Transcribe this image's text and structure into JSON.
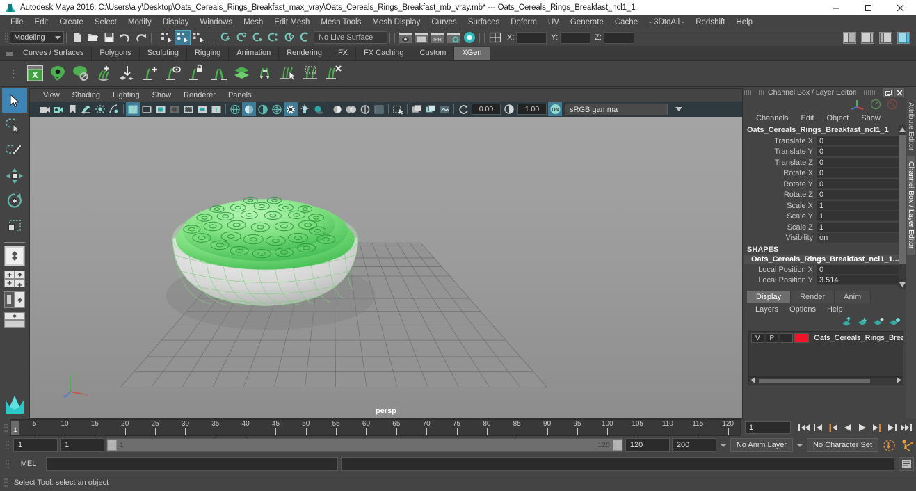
{
  "window": {
    "title": "Autodesk Maya 2016: C:\\Users\\a y\\Desktop\\Oats_Cereals_Rings_Breakfast_max_vray\\Oats_Cereals_Rings_Breakfast_mb_vray.mb*  ---  Oats_Cereals_Rings_Breakfast_ncl1_1",
    "minimize": "─",
    "maximize": "❐",
    "close": "✕"
  },
  "menubar": {
    "items": [
      "File",
      "Edit",
      "Create",
      "Select",
      "Modify",
      "Display",
      "Windows",
      "Mesh",
      "Edit Mesh",
      "Mesh Tools",
      "Mesh Display",
      "Curves",
      "Surfaces",
      "Deform",
      "UV",
      "Generate",
      "Cache",
      "- 3DtoAll -",
      "Redshift",
      "Help"
    ]
  },
  "statusline": {
    "menuset": "Modeling",
    "live_surface": "No Live Surface",
    "coord_x_label": "X:",
    "coord_y_label": "Y:",
    "coord_z_label": "Z:",
    "coord_x": "",
    "coord_y": "",
    "coord_z": ""
  },
  "shelf": {
    "tabs": [
      "Curves / Surfaces",
      "Polygons",
      "Sculpting",
      "Rigging",
      "Animation",
      "Rendering",
      "FX",
      "FX Caching",
      "Custom",
      "XGen"
    ],
    "active_tab": "XGen",
    "icons": [
      "xgen-window-icon",
      "xgen-preview-icon",
      "xgen-preview-off-icon",
      "xgen-add-description-icon",
      "xgen-place-guide-icon",
      "xgen-add-guide-icon",
      "xgen-guide-visibility-icon",
      "xgen-lock-guide-icon",
      "xgen-mirror-guide-icon",
      "xgen-layers-icon",
      "xgen-convert-guide-icon",
      "xgen-select-guide-icon",
      "xgen-region-icon",
      "xgen-delete-guide-icon"
    ]
  },
  "toolbox": {
    "tools": [
      {
        "name": "select-tool",
        "selected": true
      },
      {
        "name": "lasso-select-tool",
        "selected": false
      },
      {
        "name": "paint-select-tool",
        "selected": false
      },
      {
        "name": "move-tool",
        "selected": false
      },
      {
        "name": "rotate-tool",
        "selected": false
      },
      {
        "name": "scale-tool",
        "selected": false
      }
    ]
  },
  "viewport": {
    "menus": [
      "View",
      "Shading",
      "Lighting",
      "Show",
      "Renderer",
      "Panels"
    ],
    "exposure": "0.00",
    "gamma": "1.00",
    "color_profile": "sRGB gamma",
    "camera_label": "persp"
  },
  "channelbox": {
    "panel_title": "Channel Box / Layer Editor",
    "menus": [
      "Channels",
      "Edit",
      "Object",
      "Show"
    ],
    "object_name": "Oats_Cereals_Rings_Breakfast_ncl1_1",
    "channels": [
      {
        "label": "Translate X",
        "value": "0"
      },
      {
        "label": "Translate Y",
        "value": "0"
      },
      {
        "label": "Translate Z",
        "value": "0"
      },
      {
        "label": "Rotate X",
        "value": "0"
      },
      {
        "label": "Rotate Y",
        "value": "0"
      },
      {
        "label": "Rotate Z",
        "value": "0"
      },
      {
        "label": "Scale X",
        "value": "1"
      },
      {
        "label": "Scale Y",
        "value": "1"
      },
      {
        "label": "Scale Z",
        "value": "1"
      },
      {
        "label": "Visibility",
        "value": "on"
      }
    ],
    "shapes_header": "SHAPES",
    "shape_name": "Oats_Cereals_Rings_Breakfast_ncl1_1...",
    "shape_channels": [
      {
        "label": "Local Position X",
        "value": "0"
      },
      {
        "label": "Local Position Y",
        "value": "3.514"
      }
    ]
  },
  "layereditor": {
    "tabs": [
      "Display",
      "Render",
      "Anim"
    ],
    "active_tab": "Display",
    "menus": [
      "Layers",
      "Options",
      "Help"
    ],
    "buttons": [
      "move-layer-up-icon",
      "move-layer-down-icon",
      "new-layer-icon",
      "new-layer-from-selected-icon"
    ],
    "layers": [
      {
        "visibility": "V",
        "playback": "P",
        "type": "",
        "color": "#f01428",
        "name": "Oats_Cereals_Rings_Brea"
      }
    ]
  },
  "timeline": {
    "ticks": [
      5,
      10,
      15,
      20,
      25,
      30,
      35,
      40,
      45,
      50,
      55,
      60,
      65,
      70,
      75,
      80,
      85,
      90,
      95,
      100,
      105,
      110,
      115,
      120
    ],
    "current_frame_marker": "1",
    "current_frame_field": "1",
    "playback_buttons": [
      "go-to-start-icon",
      "step-back-key-icon",
      "step-back-frame-icon",
      "play-backwards-icon",
      "play-forwards-icon",
      "step-forward-frame-icon",
      "step-forward-key-icon",
      "go-to-end-icon"
    ]
  },
  "rangeslider": {
    "anim_start": "1",
    "playback_start": "1",
    "range_start_label": "1",
    "range_end_label": "120",
    "playback_end": "120",
    "anim_end": "200",
    "anim_layer": "No Anim Layer",
    "character_set": "No Character Set",
    "auto_key_icon": "auto-keyframe-icon",
    "anim_prefs_icon": "animation-preferences-icon"
  },
  "commandline": {
    "language": "MEL",
    "input_value": "",
    "output_value": "",
    "script_editor_icon": "script-editor-icon"
  },
  "helpline": {
    "text": "Select Tool: select an object"
  }
}
